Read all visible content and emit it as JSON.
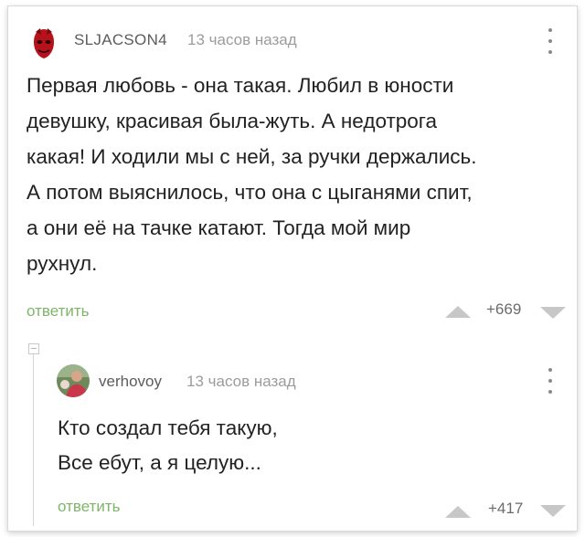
{
  "comments": [
    {
      "username": "SLJACSON4",
      "time": "13 часов назад",
      "avatar_icon": "red-mask-avatar",
      "text": "Первая любовь - она такая. Любил в юности\nдевушку, красивая была-жуть. А недотрога\nкакая! И ходили мы с ней, за  ручки держались.\nА потом выяснилось, что она с цыганями спит,\nа они её на тачке катают. Тогда мой мир\nрухнул.",
      "reply_label": "ответить",
      "rating": "+669"
    },
    {
      "username": "verhovoy",
      "time": "13 часов назад",
      "avatar_icon": "photo-avatar",
      "text": "Кто создал тебя такую,\nВсе ебут, а я целую...",
      "reply_label": "ответить",
      "rating": "+417"
    }
  ],
  "colors": {
    "reply_link": "#7fb56a",
    "text": "#222222",
    "meta": "#9c9c9c",
    "vote_arrow": "#c7c7c7"
  }
}
